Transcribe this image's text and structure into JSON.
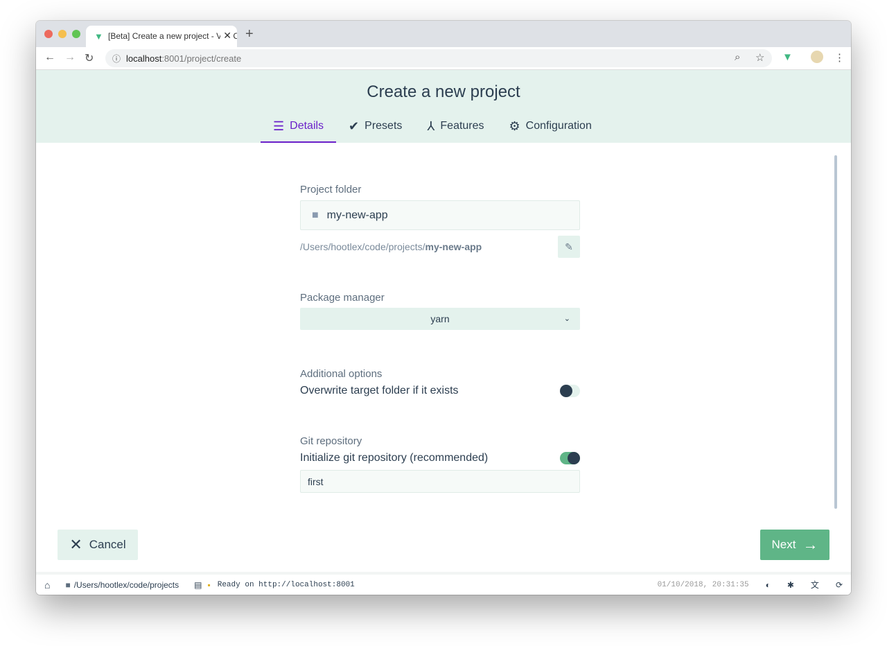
{
  "browser": {
    "tab_title": "[Beta] Create a new project - Vue CLI",
    "url_host": "localhost",
    "url_path": ":8001/project/create"
  },
  "header": {
    "title": "Create a new project",
    "tabs": [
      {
        "label": "Details",
        "icon": "list-icon"
      },
      {
        "label": "Presets",
        "icon": "check-circle-icon"
      },
      {
        "label": "Features",
        "icon": "fork-icon"
      },
      {
        "label": "Configuration",
        "icon": "settings-icon"
      }
    ]
  },
  "form": {
    "folder_label": "Project folder",
    "folder_value": "my-new-app",
    "path_prefix": "/Users/hootlex/code/projects/",
    "path_name": "my-new-app",
    "pm_label": "Package manager",
    "pm_value": "yarn",
    "additional_label": "Additional options",
    "overwrite_label": "Overwrite target folder if it exists",
    "overwrite_on": false,
    "git_label": "Git repository",
    "git_init_label": "Initialize git repository (recommended)",
    "git_on": true,
    "git_message": "first"
  },
  "actions": {
    "cancel": "Cancel",
    "next": "Next"
  },
  "statusbar": {
    "cwd": "/Users/hootlex/code/projects",
    "log": "Ready on http://localhost:8001",
    "datetime": "01/10/2018, 20:31:35"
  },
  "colors": {
    "accent": "#6a1fc9",
    "primary": "#5fb587",
    "header_bg": "#e4f2ed",
    "dark": "#2c3e50"
  }
}
